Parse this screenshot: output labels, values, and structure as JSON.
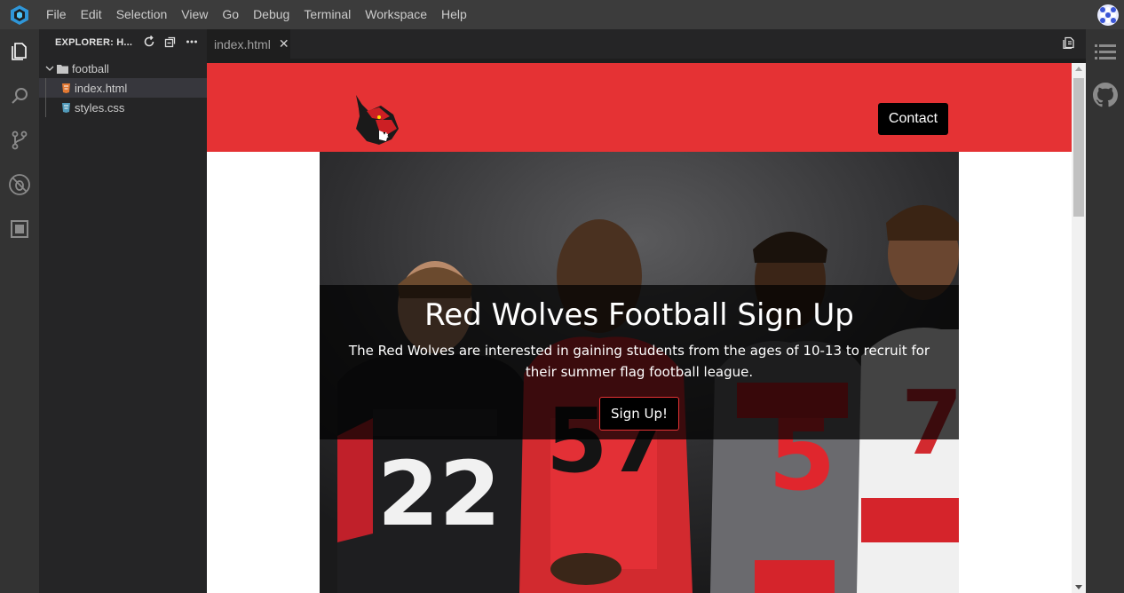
{
  "menu": [
    "File",
    "Edit",
    "Selection",
    "View",
    "Go",
    "Debug",
    "Terminal",
    "Workspace",
    "Help"
  ],
  "explorer": {
    "title": "EXPLORER: H...",
    "folder": "football",
    "files": [
      "index.html",
      "styles.css"
    ]
  },
  "tabs": [
    {
      "label": "index.html"
    }
  ],
  "site": {
    "header_color": "#e53234",
    "contact_label": "Contact",
    "hero_title": "Red Wolves Football Sign Up",
    "hero_text": "The Red Wolves are interested in gaining students from the ages of 10-13 to recruit for their summer flag football league.",
    "signup_label": "Sign Up!"
  },
  "icons": {
    "app_logo": "cube-logo-icon",
    "activity": [
      "files-icon",
      "search-icon",
      "source-control-icon",
      "debug-icon",
      "extensions-icon"
    ],
    "right": [
      "outline-icon",
      "github-icon"
    ]
  }
}
